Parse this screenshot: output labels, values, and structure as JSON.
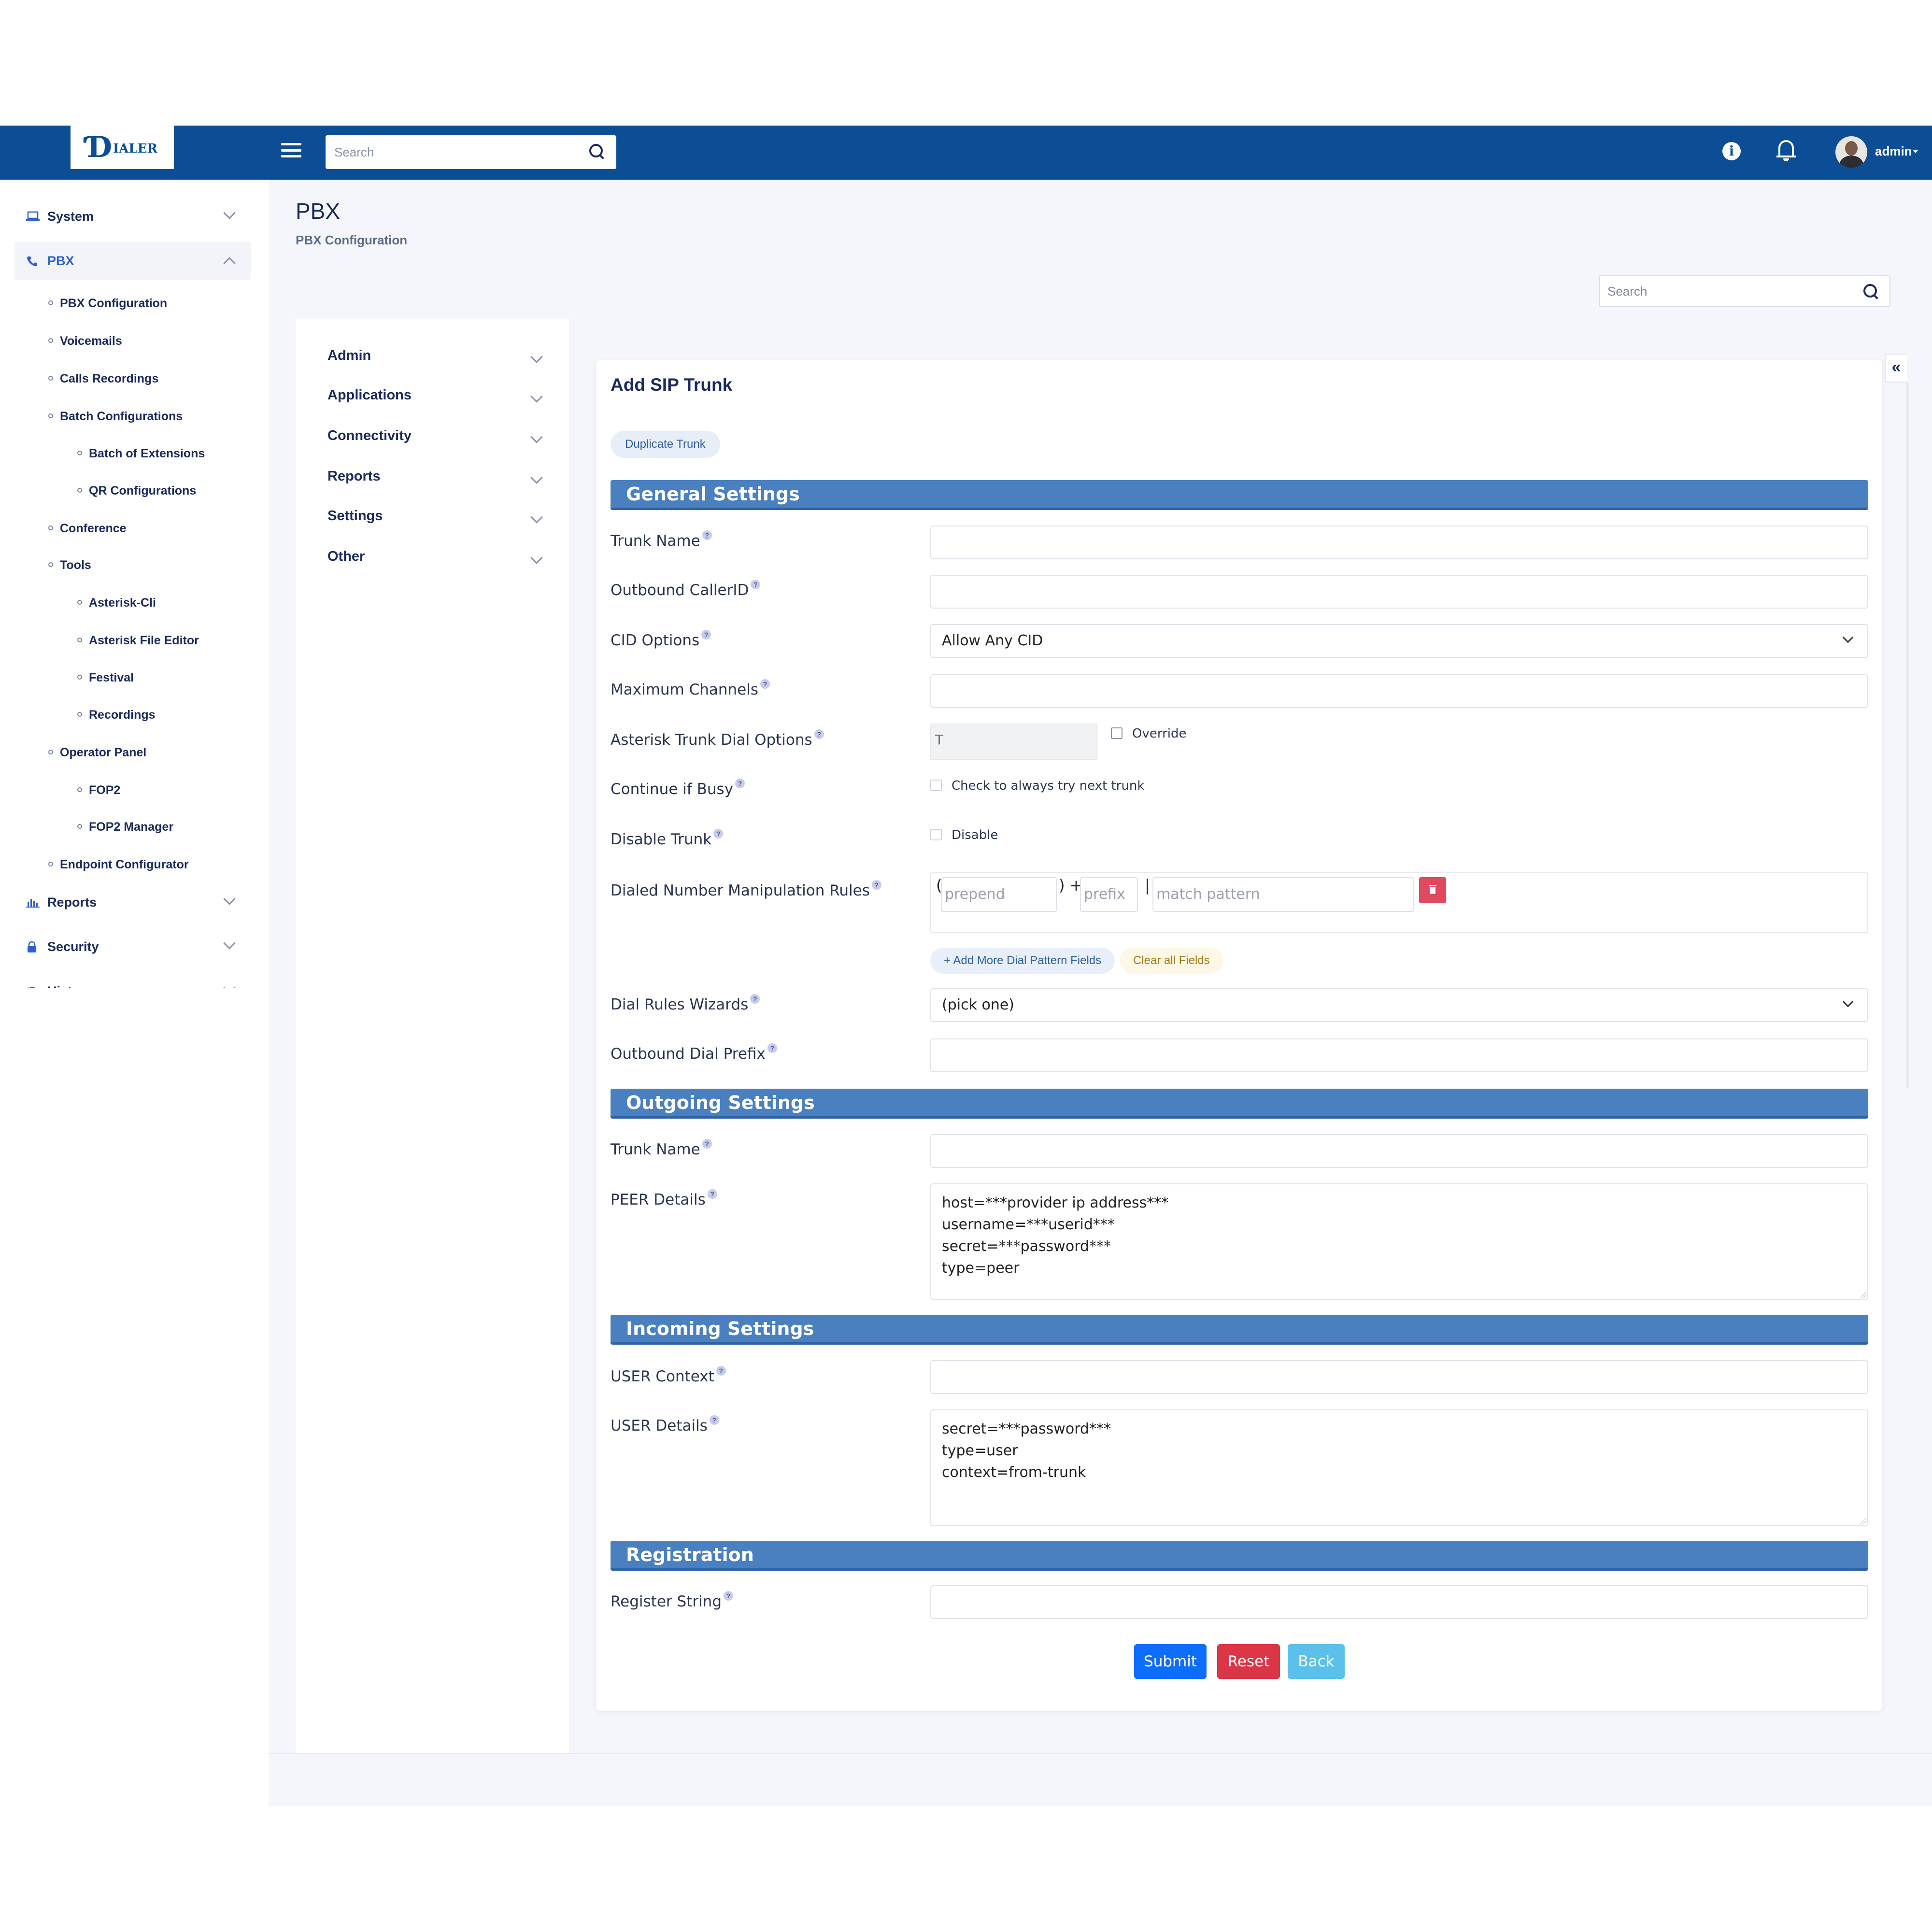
{
  "topbar": {
    "logo_mark": "Ɗ",
    "logo_text": "IALER",
    "search_placeholder": "Search",
    "user_name": "admin",
    "colors": {
      "bar": "#0c4e96",
      "accent": "#2f5fd0"
    }
  },
  "sidebar": {
    "groups": [
      {
        "label": "System",
        "icon": "laptop-icon"
      },
      {
        "label": "PBX",
        "icon": "phone-icon"
      },
      {
        "label": "Reports",
        "icon": "bar-chart-icon"
      },
      {
        "label": "Security",
        "icon": "lock-icon"
      },
      {
        "label": "History",
        "icon": "history-icon"
      }
    ],
    "pbx_items": [
      "PBX Configuration",
      "Voicemails",
      "Calls Recordings",
      "Batch Configurations",
      "Batch of Extensions",
      "QR Configurations",
      "Conference",
      "Tools",
      "Asterisk-Cli",
      "Asterisk File Editor",
      "Festival",
      "Recordings",
      "Operator Panel",
      "FOP2",
      "FOP2 Manager",
      "Endpoint Configurator"
    ]
  },
  "page": {
    "title": "PBX",
    "subtitle": "PBX Configuration",
    "search_placeholder": "Search",
    "collapse_glyph": "«"
  },
  "inner_menu": [
    "Admin",
    "Applications",
    "Connectivity",
    "Reports",
    "Settings",
    "Other"
  ],
  "form": {
    "title": "Add SIP Trunk",
    "duplicate_label": "Duplicate Trunk",
    "help_glyph": "?",
    "sections": {
      "general": "General Settings",
      "outgoing": "Outgoing Settings",
      "incoming": "Incoming Settings",
      "registration": "Registration"
    },
    "labels": {
      "trunk_name": "Trunk Name",
      "outbound_callerid": "Outbound CallerID",
      "cid_options": "CID Options",
      "max_channels": "Maximum Channels",
      "dial_options": "Asterisk Trunk Dial Options",
      "continue_busy": "Continue if Busy",
      "disable_trunk": "Disable Trunk",
      "dnm_rules": "Dialed Number Manipulation Rules",
      "dial_wizards": "Dial Rules Wizards",
      "outbound_prefix": "Outbound Dial Prefix",
      "out_trunk_name": "Trunk Name",
      "peer_details": "PEER Details",
      "user_context": "USER Context",
      "user_details": "USER Details",
      "register_string": "Register String"
    },
    "values": {
      "cid_options": "Allow Any CID",
      "dial_options": "T",
      "override_label": "Override",
      "continue_busy_label": "Check to always try next trunk",
      "disable_label": "Disable",
      "dial_wizards": "(pick one)",
      "peer_details": "host=***provider ip address***\nusername=***userid***\nsecret=***password***\ntype=peer",
      "user_details": "secret=***password***\ntype=user\ncontext=from-trunk"
    },
    "dnm": {
      "open_paren": "(",
      "close_plus": ") +",
      "pipe": "|",
      "prepend_placeholder": "prepend",
      "prefix_placeholder": "prefix",
      "match_placeholder": "match pattern",
      "add_more_label": "+ Add More Dial Pattern Fields",
      "clear_label": "Clear all Fields"
    },
    "buttons": {
      "submit": "Submit",
      "reset": "Reset",
      "back": "Back"
    }
  }
}
